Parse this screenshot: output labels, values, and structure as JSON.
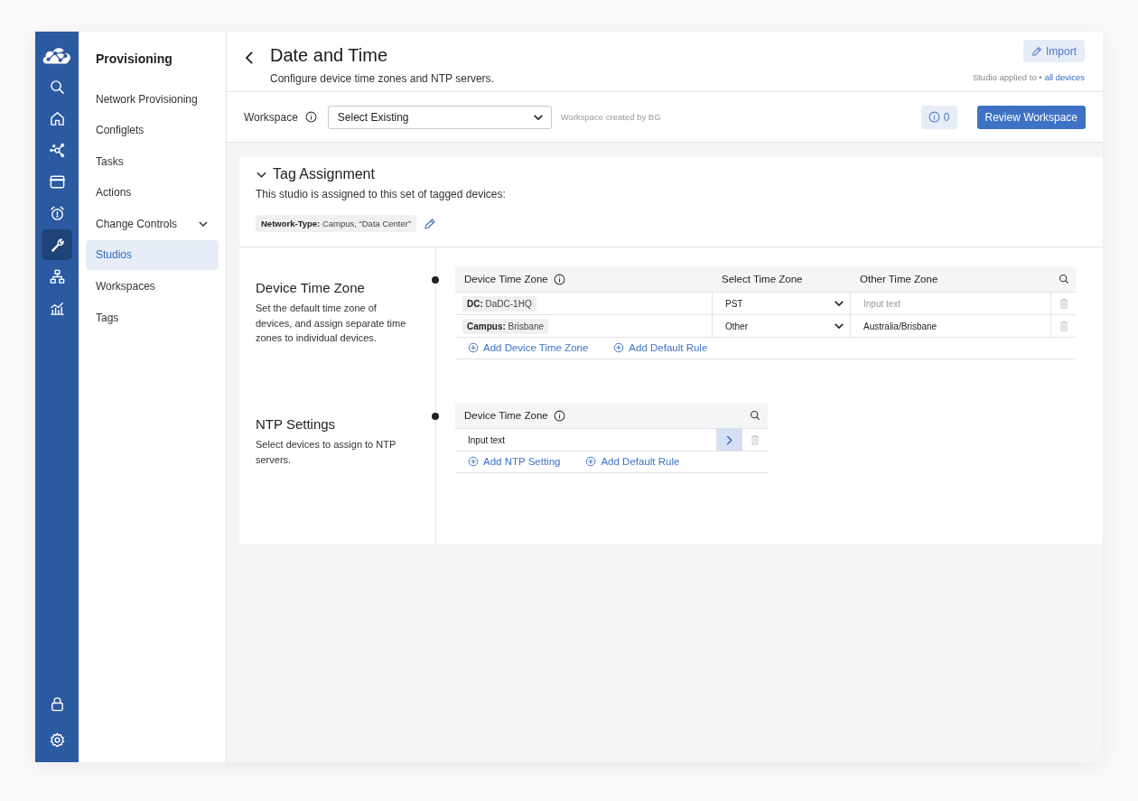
{
  "rail": {
    "items": [
      {
        "kind": "search",
        "selected": false
      },
      {
        "kind": "home",
        "selected": false
      },
      {
        "kind": "nodes",
        "selected": false
      },
      {
        "kind": "window",
        "selected": false
      },
      {
        "kind": "alarm",
        "selected": false
      },
      {
        "kind": "wrench",
        "selected": true
      },
      {
        "kind": "hierarchy",
        "selected": false
      },
      {
        "kind": "chart",
        "selected": false
      }
    ],
    "bottom": [
      {
        "kind": "lock"
      },
      {
        "kind": "settings"
      }
    ]
  },
  "sidebar": {
    "title": "Provisioning",
    "items": [
      {
        "label": "Network Provisioning",
        "selected": false,
        "expandable": false
      },
      {
        "label": "Configlets",
        "selected": false,
        "expandable": false
      },
      {
        "label": "Tasks",
        "selected": false,
        "expandable": false
      },
      {
        "label": "Actions",
        "selected": false,
        "expandable": false
      },
      {
        "label": "Change Controls",
        "selected": false,
        "expandable": true
      },
      {
        "label": "Studios",
        "selected": true,
        "expandable": false
      },
      {
        "label": "Workspaces",
        "selected": false,
        "expandable": false
      },
      {
        "label": "Tags",
        "selected": false,
        "expandable": false
      }
    ]
  },
  "header": {
    "title": "Date and Time",
    "subtitle": "Configure device time zones and NTP servers.",
    "import_button": "Import",
    "applied_label": "Studio applied to •",
    "applied_link": "all devices"
  },
  "workspace": {
    "label": "Workspace",
    "select_value": "Select Existing",
    "note": "Workspace created by BG",
    "count": "0",
    "review_button": "Review Workspace"
  },
  "tag_assignment": {
    "title": "Tag Assignment",
    "expanded": true,
    "description": "This studio is assigned to this set of tagged devices:",
    "tag": "**Network-Type:** Campus, “Data Center”"
  },
  "sections": [
    {
      "title": "Device Time Zone",
      "description": "Set the default time zone of devices, and assign separate time zones to individual devices.",
      "table": {
        "kind": "time_zone",
        "columns": [
          {
            "label": "Device Time Zone",
            "info": true
          },
          {
            "label": "Select Time Zone",
            "info": false
          },
          {
            "label": "Other Time Zone",
            "info": false
          }
        ],
        "rows": [
          [
            {
              "kind": "tag",
              "text": "**DC:** DaDC-1HQ"
            },
            {
              "kind": "select",
              "value": "PST"
            },
            {
              "kind": "input",
              "placeholder": "Input text"
            }
          ],
          [
            {
              "kind": "tag",
              "text": "**Campus:** Brisbane"
            },
            {
              "kind": "select",
              "value": "Other"
            },
            {
              "kind": "input",
              "value": "Australia/Brisbane"
            }
          ]
        ],
        "actions": [
          "Add Device Time Zone",
          "Add Default Rule"
        ]
      }
    },
    {
      "title": "NTP Settings",
      "description": "Select devices to assign to NTP servers.",
      "table": {
        "kind": "ntp",
        "columns": [
          {
            "label": "Device Time Zone",
            "info": true
          }
        ],
        "rows": [
          [
            {
              "kind": "input",
              "value": "Input text"
            },
            {
              "kind": "go"
            }
          ]
        ],
        "actions": [
          "Add NTP Setting",
          "Add Default Rule"
        ]
      }
    }
  ]
}
